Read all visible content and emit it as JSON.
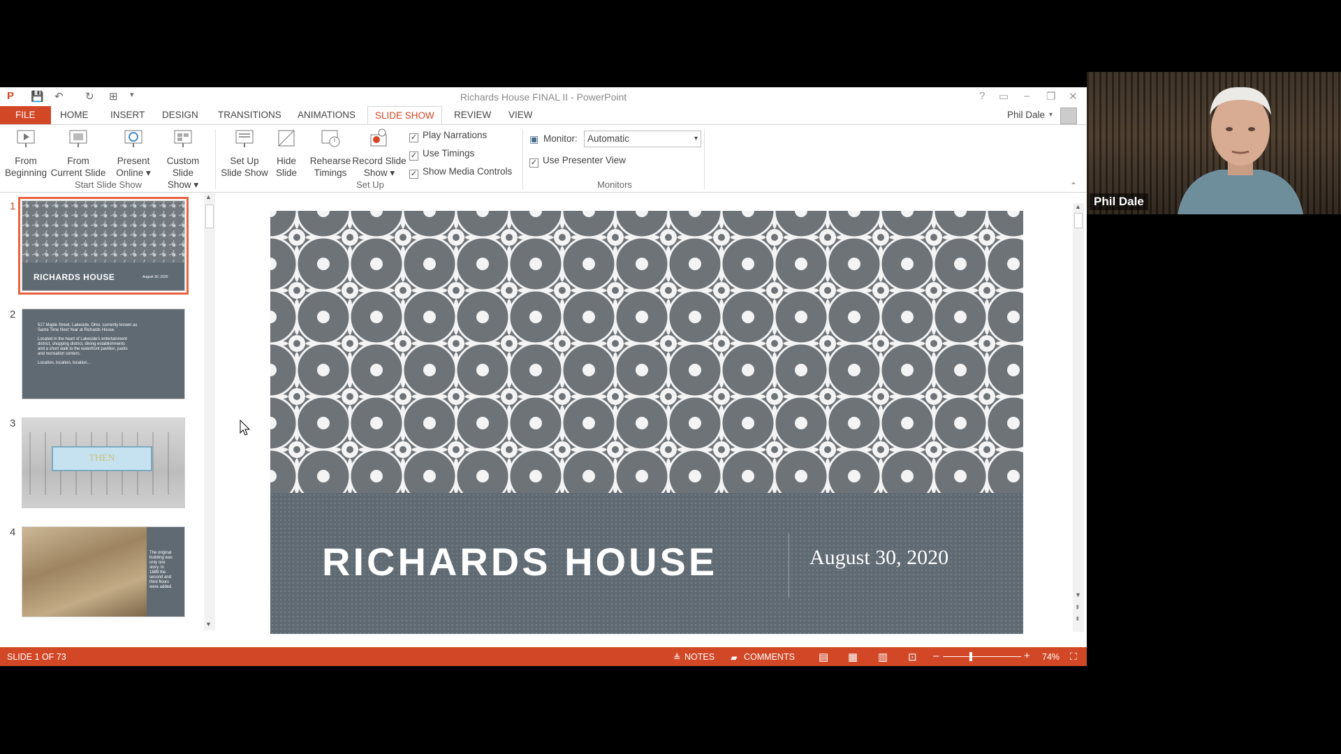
{
  "window": {
    "title": "Richards House FINAL II - PowerPoint",
    "user": "Phil Dale"
  },
  "tabs": [
    "FILE",
    "HOME",
    "INSERT",
    "DESIGN",
    "TRANSITIONS",
    "ANIMATIONS",
    "SLIDE SHOW",
    "REVIEW",
    "VIEW"
  ],
  "active_tab": "SLIDE SHOW",
  "ribbon": {
    "start": {
      "group": "Start Slide Show",
      "from_beginning": [
        "From",
        "Beginning"
      ],
      "from_current": [
        "From",
        "Current Slide"
      ],
      "present_online": [
        "Present",
        "Online ▾"
      ],
      "custom": [
        "Custom Slide",
        "Show ▾"
      ]
    },
    "setup": {
      "group": "Set Up",
      "setup_show": [
        "Set Up",
        "Slide Show"
      ],
      "hide_slide": [
        "Hide",
        "Slide"
      ],
      "rehearse": [
        "Rehearse",
        "Timings"
      ],
      "record": [
        "Record Slide",
        "Show ▾"
      ],
      "play_narrations": "Play Narrations",
      "use_timings": "Use Timings",
      "show_media": "Show Media Controls"
    },
    "monitors": {
      "group": "Monitors",
      "monitor_label": "Monitor:",
      "monitor_value": "Automatic",
      "presenter_view": "Use Presenter View"
    }
  },
  "thumbnails": [
    {
      "num": "1",
      "title": "RICHARDS HOUSE",
      "date": "August 30, 2020"
    },
    {
      "num": "2",
      "lines": [
        "517 Maple Street, Lakeside, Ohio, currently known as",
        "Same Time Next Year at Richards House.",
        "",
        "Located in the heart of Lakeside's entertainment",
        "district, shopping district, dining establishments",
        "and a short walk to the waterfront pavilion, parks",
        "and recreation centers.",
        "",
        "Location, location, location…"
      ]
    },
    {
      "num": "3",
      "label": "THEN"
    },
    {
      "num": "4",
      "lines": [
        "The original",
        "building was",
        "only one",
        "story. In",
        "1889 the",
        "second and",
        "third floors",
        "were added."
      ]
    }
  ],
  "slide": {
    "title": "RICHARDS HOUSE",
    "date": "August 30, 2020"
  },
  "status": {
    "slide_info": "SLIDE 1 OF 73",
    "notes": "NOTES",
    "comments": "COMMENTS",
    "zoom": "74%"
  },
  "webcam": {
    "name": "Phil Dale"
  },
  "colors": {
    "accent": "#d24726",
    "slide_band": "#5f6a73",
    "pattern": "#6e7378"
  }
}
